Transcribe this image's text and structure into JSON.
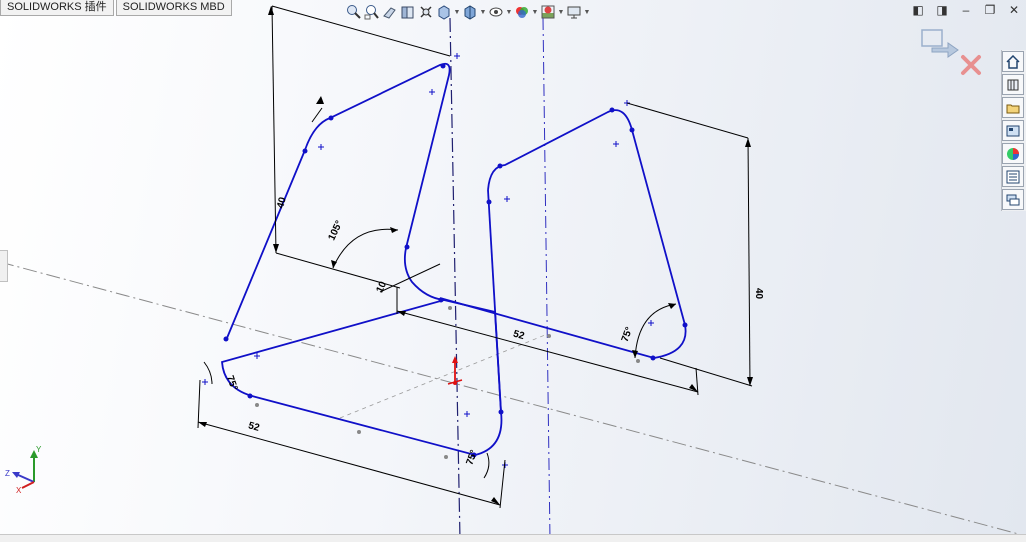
{
  "tabs": [
    {
      "label": "SOLIDWORKS 插件"
    },
    {
      "label": "SOLIDWORKS MBD"
    }
  ],
  "heads_up_toolbar": [
    "zoom-to-fit-icon",
    "zoom-to-area-icon",
    "previous-view-icon",
    "section-view-icon",
    "dynamic-annotation-icon",
    "view-orientation-icon",
    "display-style-icon",
    "hide-show-items-icon",
    "edit-appearance-icon",
    "apply-scene-icon",
    "view-settings-icon"
  ],
  "task_pane": [
    "home-icon",
    "3d-library-icon",
    "file-explorer-icon",
    "view-palette-icon",
    "appearances-icon",
    "custom-properties-icon",
    "forum-icon"
  ],
  "dimensions": {
    "left_bottom_52": "52",
    "right_bottom_52": "52",
    "left_height": "40",
    "right_height": "40",
    "angle_105": "105°",
    "angle_75_right": "75°",
    "angle_75_left": "75°",
    "angle_75_bottom": "75°",
    "small_10": "10"
  },
  "triad": {
    "x": "X",
    "y": "Y",
    "z": "Z"
  },
  "colors": {
    "sketch": "#1010c8",
    "dimension": "#000000",
    "centerline_v": "#2020a0",
    "centerline_h": "#808080"
  }
}
